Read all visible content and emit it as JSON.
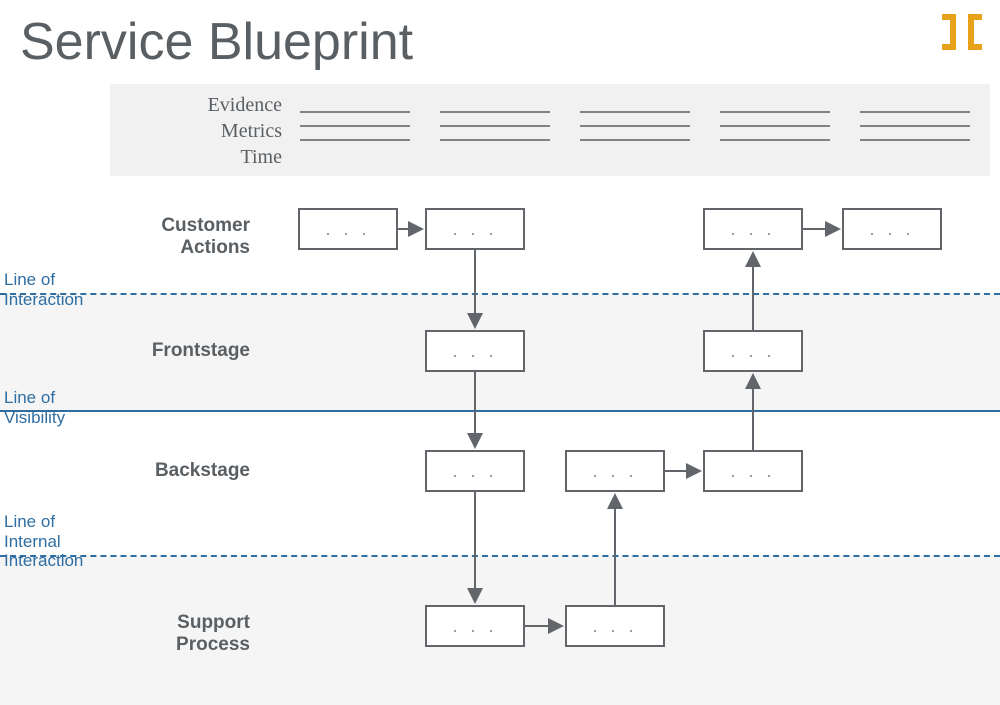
{
  "title": "Service Blueprint",
  "header": {
    "labels": [
      "Evidence",
      "Metrics",
      "Time"
    ]
  },
  "rows": {
    "customer": {
      "label_line1": "Customer",
      "label_line2": "Actions"
    },
    "frontstage": {
      "label": "Frontstage"
    },
    "backstage": {
      "label": "Backstage"
    },
    "support": {
      "label_line1": "Support",
      "label_line2": "Process"
    }
  },
  "separators": {
    "interaction": {
      "line1": "Line of",
      "line2": "Interaction"
    },
    "visibility": {
      "line1": "Line of",
      "line2": "Visibility"
    },
    "internal": {
      "line1": "Line of",
      "line2": "Internal",
      "line3": "Interaction"
    }
  },
  "box_placeholder": ". . .",
  "colors": {
    "accent_blue": "#2f6ea3",
    "text_gray": "#5a5f63",
    "box_border": "#62666a",
    "band_gray": "#f1f1f1",
    "logo_orange": "#e7a11a"
  }
}
